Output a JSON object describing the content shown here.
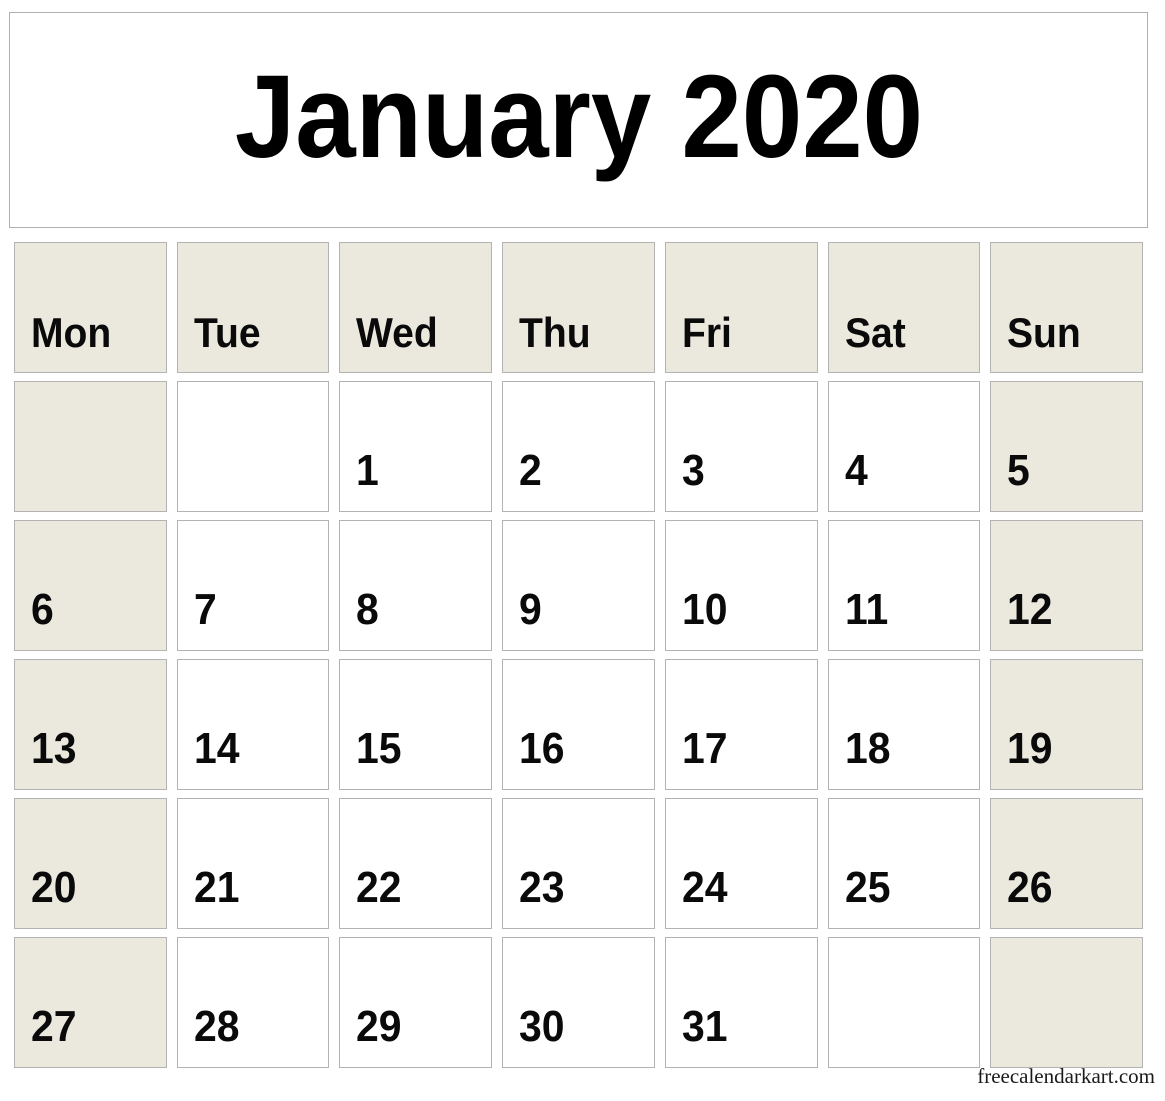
{
  "calendar": {
    "title": "January 2020",
    "month": "January",
    "year": "2020",
    "week_start": "Mon",
    "weekday_headers": [
      {
        "label": "Mon",
        "shaded": true
      },
      {
        "label": "Tue",
        "shaded": true
      },
      {
        "label": "Wed",
        "shaded": true
      },
      {
        "label": "Thu",
        "shaded": true
      },
      {
        "label": "Fri",
        "shaded": true
      },
      {
        "label": "Sat",
        "shaded": true
      },
      {
        "label": "Sun",
        "shaded": true
      }
    ],
    "weeks": [
      [
        {
          "day": "",
          "shaded": true
        },
        {
          "day": "",
          "shaded": false
        },
        {
          "day": "1",
          "shaded": false
        },
        {
          "day": "2",
          "shaded": false
        },
        {
          "day": "3",
          "shaded": false
        },
        {
          "day": "4",
          "shaded": false
        },
        {
          "day": "5",
          "shaded": true
        }
      ],
      [
        {
          "day": "6",
          "shaded": true
        },
        {
          "day": "7",
          "shaded": false
        },
        {
          "day": "8",
          "shaded": false
        },
        {
          "day": "9",
          "shaded": false
        },
        {
          "day": "10",
          "shaded": false
        },
        {
          "day": "11",
          "shaded": false
        },
        {
          "day": "12",
          "shaded": true
        }
      ],
      [
        {
          "day": "13",
          "shaded": true
        },
        {
          "day": "14",
          "shaded": false
        },
        {
          "day": "15",
          "shaded": false
        },
        {
          "day": "16",
          "shaded": false
        },
        {
          "day": "17",
          "shaded": false
        },
        {
          "day": "18",
          "shaded": false
        },
        {
          "day": "19",
          "shaded": true
        }
      ],
      [
        {
          "day": "20",
          "shaded": true
        },
        {
          "day": "21",
          "shaded": false
        },
        {
          "day": "22",
          "shaded": false
        },
        {
          "day": "23",
          "shaded": false
        },
        {
          "day": "24",
          "shaded": false
        },
        {
          "day": "25",
          "shaded": false
        },
        {
          "day": "26",
          "shaded": true
        }
      ],
      [
        {
          "day": "27",
          "shaded": true
        },
        {
          "day": "28",
          "shaded": false
        },
        {
          "day": "29",
          "shaded": false
        },
        {
          "day": "30",
          "shaded": false
        },
        {
          "day": "31",
          "shaded": false
        },
        {
          "day": "",
          "shaded": false
        },
        {
          "day": "",
          "shaded": true
        }
      ]
    ],
    "watermark": "freecalendarkart.com",
    "colors": {
      "page_background": "#ffffff",
      "cell_background": "#ffffff",
      "shaded_cell_background": "#ebe9de",
      "header_background": "#ebe9de",
      "cell_border": "#b3b3b3",
      "panel_border": "#b0b0b0",
      "text": "#0a0a0a",
      "watermark_text": "#1a1a1a"
    }
  }
}
